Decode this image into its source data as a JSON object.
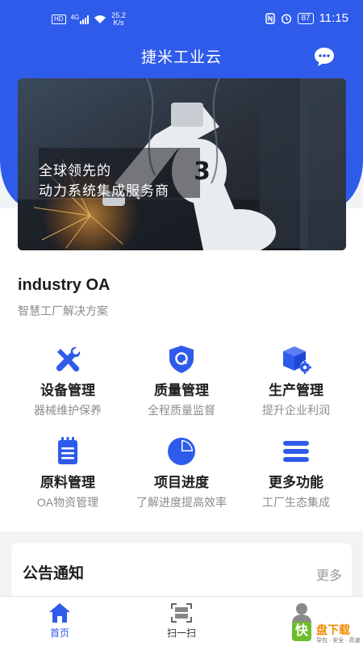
{
  "status_bar": {
    "left_indicator": "HD",
    "signal_label": "4G",
    "net_speed": "25.2",
    "net_unit": "K/s",
    "battery": "87",
    "time": "11:15"
  },
  "header": {
    "title": "捷米工业云",
    "chat_icon": "chat-bubble-icon"
  },
  "banner": {
    "line1": "全球领先的",
    "line2": "动力系统集成服务商"
  },
  "company": {
    "name": "industry OA",
    "subtitle": "智慧工厂解决方案"
  },
  "features": [
    {
      "title": "设备管理",
      "subtitle": "器械维护保养",
      "icon": "tools-icon"
    },
    {
      "title": "质量管理",
      "subtitle": "全程质量监督",
      "icon": "shield-q-icon"
    },
    {
      "title": "生产管理",
      "subtitle": "提升企业利润",
      "icon": "production-cube-icon"
    },
    {
      "title": "原料管理",
      "subtitle": "OA物资管理",
      "icon": "notepad-icon"
    },
    {
      "title": "项目进度",
      "subtitle": "了解进度提高效率",
      "icon": "pie-chart-icon"
    },
    {
      "title": "更多功能",
      "subtitle": "工厂生态集成",
      "icon": "menu-icon"
    }
  ],
  "notice": {
    "title": "公告通知",
    "more": "更多"
  },
  "tabbar": {
    "home": "首页",
    "scan": "扫一扫"
  },
  "watermark": {
    "badge": "快",
    "name": "盘下载",
    "tagline": "导包 · 安全 · 高速"
  },
  "colors": {
    "primary": "#2f5bea",
    "text_dark": "#1d1d1f",
    "text_muted": "#8c8c8c",
    "background": "#f2f3f5"
  }
}
